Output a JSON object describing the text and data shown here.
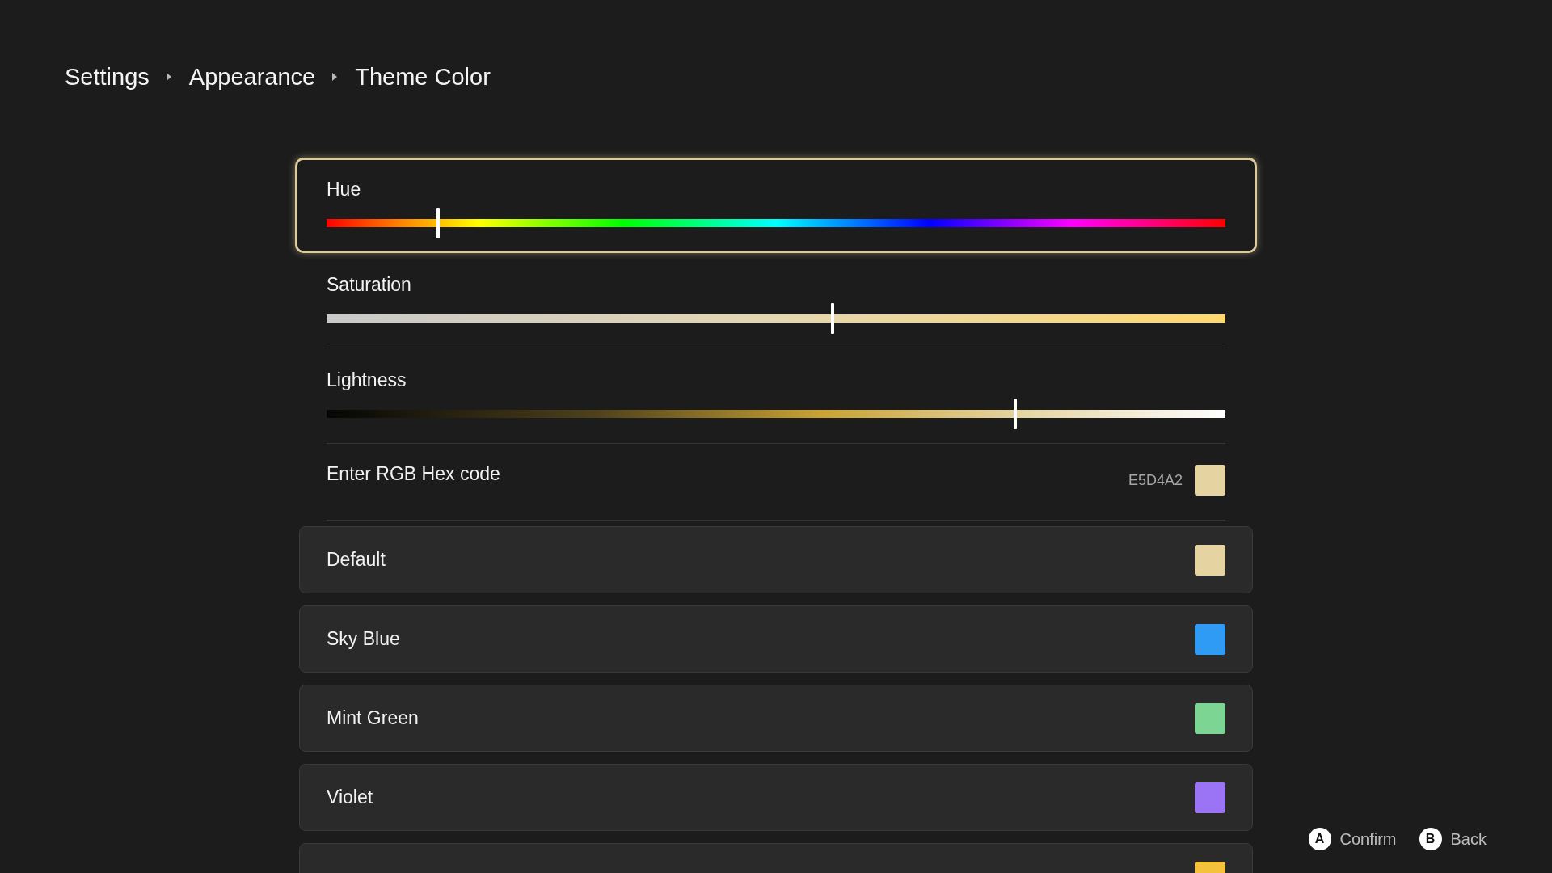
{
  "breadcrumb": [
    "Settings",
    "Appearance",
    "Theme Color"
  ],
  "sliders": [
    {
      "kind": "hue",
      "label": "Hue",
      "level": 0.124,
      "selected": true
    },
    {
      "kind": "saturation",
      "label": "Saturation",
      "level": 0.563,
      "selected": false
    },
    {
      "kind": "lightness",
      "label": "Lightness",
      "level": 0.766,
      "selected": false
    }
  ],
  "hex_entry": {
    "label": "Enter RGB Hex code",
    "value": "E5D4A2",
    "color": "#e5d4a2",
    "selected": false
  },
  "presets": [
    {
      "label": "Default",
      "color": "#e5d4a2",
      "selected": false
    },
    {
      "label": "Sky Blue",
      "color": "#309bf4",
      "selected": false
    },
    {
      "label": "Mint Green",
      "color": "#7dd594",
      "selected": false
    },
    {
      "label": "Violet",
      "color": "#9a74f4",
      "selected": false
    },
    {
      "color": "#f5c33b",
      "selected": false
    }
  ],
  "hints": [
    {
      "key": "A",
      "label": "Confirm"
    },
    {
      "key": "B",
      "label": "Back"
    }
  ]
}
